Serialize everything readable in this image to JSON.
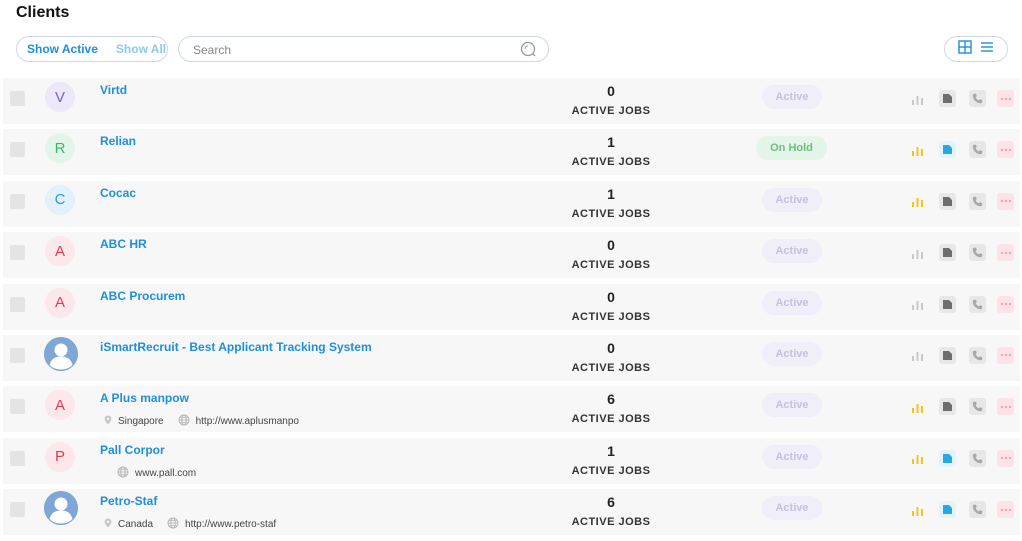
{
  "page": {
    "title": "Clients"
  },
  "filters": {
    "show_active": "Show Active",
    "show_all": "Show All"
  },
  "search": {
    "placeholder": "Search",
    "value": ""
  },
  "colors": {
    "accent": "#1f8fd6",
    "yellow": "#f5c518",
    "grey_icon": "#6d6d6d",
    "blue_icon": "#2aa7e0",
    "more_red": "#f2a3b3"
  },
  "clients": [
    {
      "initial": "V",
      "avatar_type": "letter",
      "avatar_bg": "#ece8fa",
      "avatar_fg": "#7a5cd6",
      "name": "Virtd",
      "jobs_count": "0",
      "jobs_label": "ACTIVE JOBS",
      "status": "Active",
      "status_type": "active",
      "chart_highlight": false,
      "doc_highlight": false,
      "location": "",
      "website": ""
    },
    {
      "initial": "R",
      "avatar_type": "letter",
      "avatar_bg": "#e3f5e9",
      "avatar_fg": "#3cb56a",
      "name": "Relian",
      "jobs_count": "1",
      "jobs_label": "ACTIVE JOBS",
      "status": "On Hold",
      "status_type": "hold",
      "chart_highlight": true,
      "doc_highlight": true,
      "location": "",
      "website": ""
    },
    {
      "initial": "C",
      "avatar_type": "letter",
      "avatar_bg": "#e2f1fb",
      "avatar_fg": "#2a9ee0",
      "name": "Cocac",
      "jobs_count": "1",
      "jobs_label": "ACTIVE JOBS",
      "status": "Active",
      "status_type": "active",
      "chart_highlight": true,
      "doc_highlight": false,
      "location": "",
      "website": ""
    },
    {
      "initial": "A",
      "avatar_type": "letter",
      "avatar_bg": "#fce7eb",
      "avatar_fg": "#e03c55",
      "name": "ABC HR",
      "jobs_count": "0",
      "jobs_label": "ACTIVE JOBS",
      "status": "Active",
      "status_type": "active",
      "chart_highlight": false,
      "doc_highlight": false,
      "location": "",
      "website": ""
    },
    {
      "initial": "A",
      "avatar_type": "letter",
      "avatar_bg": "#fce7eb",
      "avatar_fg": "#e03c55",
      "name": "ABC Procurem",
      "jobs_count": "0",
      "jobs_label": "ACTIVE JOBS",
      "status": "Active",
      "status_type": "active",
      "chart_highlight": false,
      "doc_highlight": false,
      "location": "",
      "website": ""
    },
    {
      "initial": "",
      "avatar_type": "person",
      "avatar_bg": "#7ea6d6",
      "avatar_fg": "#ffffff",
      "name": "iSmartRecruit - Best Applicant Tracking System",
      "jobs_count": "0",
      "jobs_label": "ACTIVE JOBS",
      "status": "Active",
      "status_type": "active",
      "chart_highlight": false,
      "doc_highlight": false,
      "location": "",
      "website": ""
    },
    {
      "initial": "A",
      "avatar_type": "letter",
      "avatar_bg": "#fce7eb",
      "avatar_fg": "#e03c55",
      "name": "A Plus manpow",
      "jobs_count": "6",
      "jobs_label": "ACTIVE JOBS",
      "status": "Active",
      "status_type": "active",
      "chart_highlight": true,
      "doc_highlight": false,
      "location": "Singapore",
      "website": "http://www.aplusmanpo"
    },
    {
      "initial": "P",
      "avatar_type": "letter",
      "avatar_bg": "#fce7eb",
      "avatar_fg": "#e03c55",
      "name": "Pall Corpor",
      "jobs_count": "1",
      "jobs_label": "ACTIVE JOBS",
      "status": "Active",
      "status_type": "active",
      "chart_highlight": true,
      "doc_highlight": true,
      "location": "",
      "website": "www.pall.com"
    },
    {
      "initial": "",
      "avatar_type": "person",
      "avatar_bg": "#7ea6d6",
      "avatar_fg": "#ffffff",
      "name": "Petro-Staf",
      "jobs_count": "6",
      "jobs_label": "ACTIVE JOBS",
      "status": "Active",
      "status_type": "active",
      "chart_highlight": true,
      "doc_highlight": true,
      "location": "Canada",
      "website": "http://www.petro-staf"
    }
  ]
}
